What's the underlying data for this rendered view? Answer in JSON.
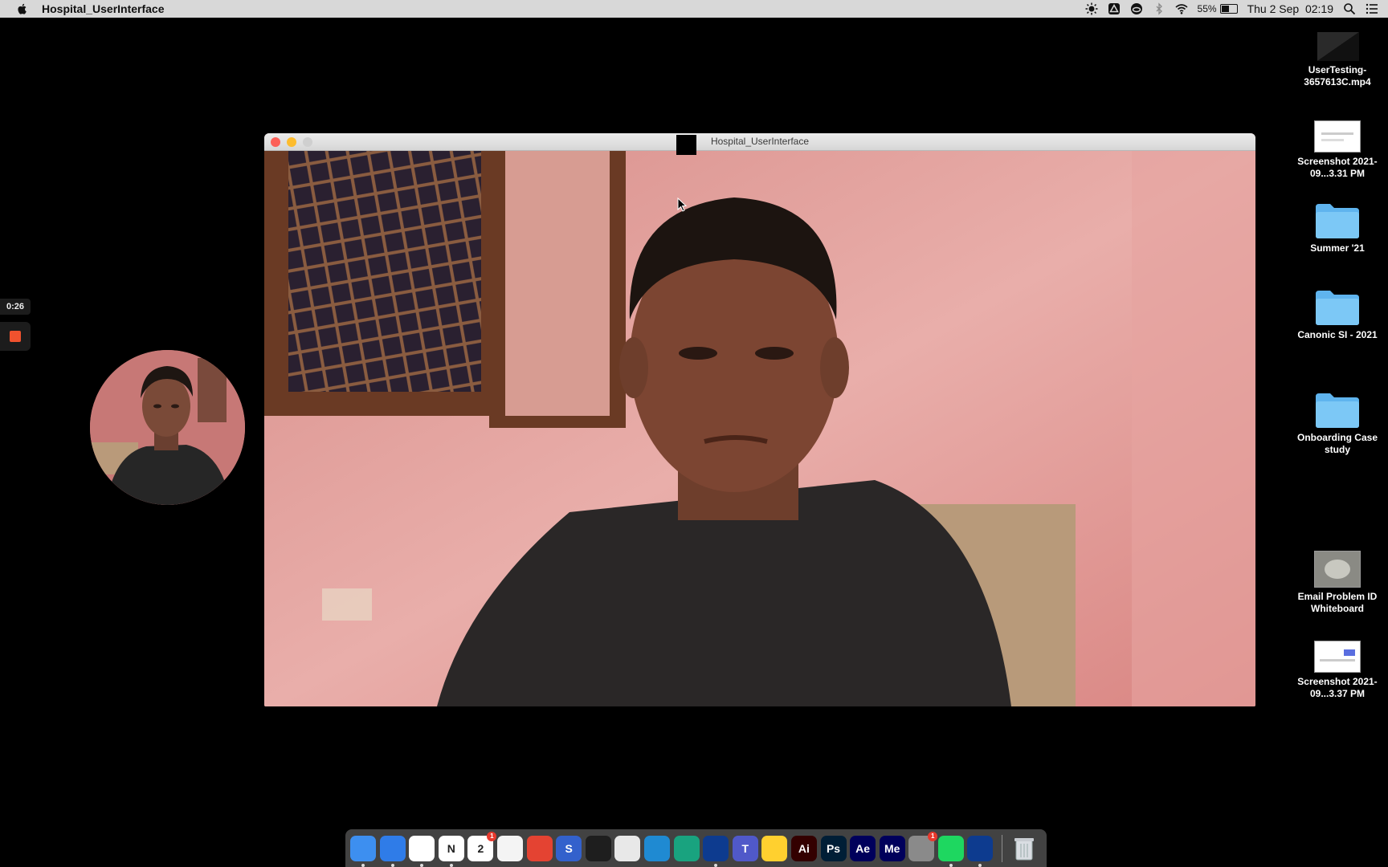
{
  "menubar": {
    "app_name": "Hospital_UserInterface",
    "battery_percent": "55%",
    "battery_level": 0.55,
    "datetime": "Thu 2 Sep  02:19"
  },
  "recorder": {
    "elapsed": "0:26",
    "stop_color": "#f0522e"
  },
  "window": {
    "title": "Hospital_UserInterface"
  },
  "desktop": {
    "items": [
      {
        "label": "UserTesting-3657613C.mp4",
        "kind": "video-file"
      },
      {
        "label": "Screenshot 2021-09...3.31 PM",
        "kind": "image-file"
      },
      {
        "label": "Summer '21",
        "kind": "folder"
      },
      {
        "label": "Canonic SI - 2021",
        "kind": "folder"
      },
      {
        "label": "Onboarding Case study",
        "kind": "folder"
      },
      {
        "label": "Email Problem ID Whiteboard",
        "kind": "image-file"
      },
      {
        "label": "Screenshot 2021-09...3.37 PM",
        "kind": "image-file"
      }
    ]
  },
  "dock": {
    "apps": [
      {
        "name": "finder-icon",
        "text": "",
        "color": "#3d8ff0",
        "running": true
      },
      {
        "name": "safari-icon",
        "text": "",
        "color": "#2f7ce8",
        "running": true
      },
      {
        "name": "chrome-icon",
        "text": "",
        "color": "#ffffff",
        "running": true
      },
      {
        "name": "notion-icon",
        "text": "N",
        "color": "#ffffff",
        "running": true
      },
      {
        "name": "calendar-icon",
        "text": "2",
        "color": "#ffffff",
        "running": false,
        "badge": "1"
      },
      {
        "name": "reminders-icon",
        "text": "",
        "color": "#f4f4f4",
        "running": false
      },
      {
        "name": "todoist-icon",
        "text": "",
        "color": "#e44332",
        "running": false
      },
      {
        "name": "simplenote-icon",
        "text": "S",
        "color": "#3361cc",
        "running": false
      },
      {
        "name": "figma-icon",
        "text": "",
        "color": "#1e1e1e",
        "running": false
      },
      {
        "name": "preview-window-icon",
        "text": "",
        "color": "#e8e8e8",
        "running": false
      },
      {
        "name": "vscode-icon",
        "text": "",
        "color": "#1f8ad2",
        "running": false
      },
      {
        "name": "chatgpt-icon",
        "text": "",
        "color": "#19a37f",
        "running": false
      },
      {
        "name": "azure-data-studio-icon",
        "text": "",
        "color": "#0d3b8f",
        "running": true
      },
      {
        "name": "teams-icon",
        "text": "T",
        "color": "#5059c9",
        "running": false
      },
      {
        "name": "miro-icon",
        "text": "",
        "color": "#ffd02f",
        "running": false
      },
      {
        "name": "illustrator-icon",
        "text": "Ai",
        "color": "#330000",
        "running": false
      },
      {
        "name": "photoshop-icon",
        "text": "Ps",
        "color": "#001e36",
        "running": false
      },
      {
        "name": "after-effects-icon",
        "text": "Ae",
        "color": "#00005b",
        "running": false
      },
      {
        "name": "media-encoder-icon",
        "text": "Me",
        "color": "#00005b",
        "running": false
      },
      {
        "name": "system-preferences-icon",
        "text": "",
        "color": "#8a8a8a",
        "running": false,
        "badge": "1"
      },
      {
        "name": "spotify-icon",
        "text": "",
        "color": "#1ed760",
        "running": true
      },
      {
        "name": "azure-data-studio-2-icon",
        "text": "",
        "color": "#0d3b8f",
        "running": true
      }
    ],
    "trash": {
      "name": "trash-icon"
    }
  }
}
